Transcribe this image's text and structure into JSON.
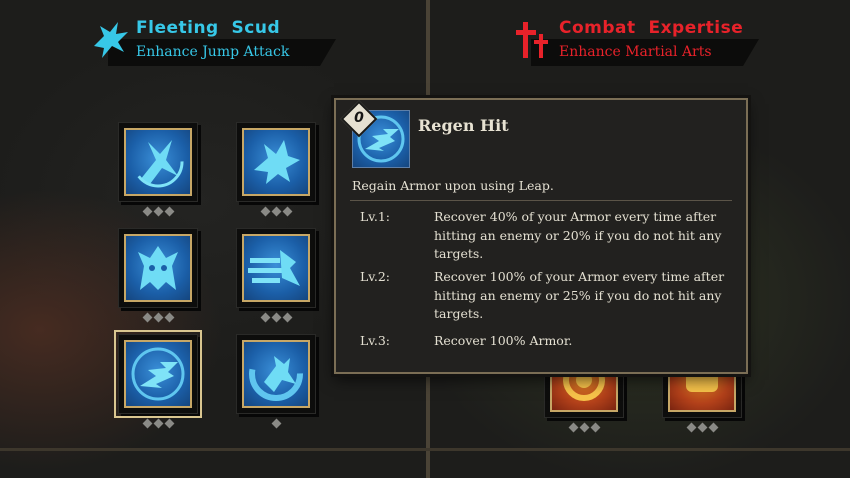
{
  "trees": {
    "left": {
      "title": "Fleeting  Scud",
      "subtitle": "Enhance Jump Attack",
      "icon": "wing-icon",
      "color": "#37c8e8"
    },
    "right": {
      "title": "Combat  Expertise",
      "subtitle": "Enhance Martial Arts",
      "icon": "weapon-icon",
      "color": "#e8222a"
    }
  },
  "skills": [
    {
      "name": "skill-1",
      "icon": "crossed-wing-icon",
      "level": 0,
      "max": 3
    },
    {
      "name": "skill-2",
      "icon": "leaping-claw-icon",
      "level": 0,
      "max": 3
    },
    {
      "name": "skill-3",
      "icon": "beast-head-icon",
      "level": 0,
      "max": 3
    },
    {
      "name": "skill-4",
      "icon": "dash-strike-icon",
      "level": 0,
      "max": 3
    },
    {
      "name": "skill-5",
      "icon": "wing-circle-icon",
      "level": 0,
      "max": 3,
      "selected": true
    },
    {
      "name": "skill-6",
      "icon": "eagle-dive-icon",
      "level": 0,
      "max": 1
    },
    {
      "name": "skill-7",
      "icon": "flame-swirl-icon",
      "level": 0,
      "max": 3
    },
    {
      "name": "skill-8",
      "icon": "fist-icon",
      "level": 0,
      "max": 3
    }
  ],
  "tooltip": {
    "badge": "0",
    "name": "Regen Hit",
    "description": "Regain Armor upon using Leap.",
    "levels": [
      {
        "label": "Lv.1:",
        "text": "Recover 40% of your Armor every time after hitting an enemy or 20% if you do not hit any targets."
      },
      {
        "label": "Lv.2:",
        "text": "Recover 100% of your Armor every time after hitting an enemy or 25% if you do not hit any targets."
      },
      {
        "label": "Lv.3:",
        "text": "Recover 100% Armor."
      }
    ]
  }
}
